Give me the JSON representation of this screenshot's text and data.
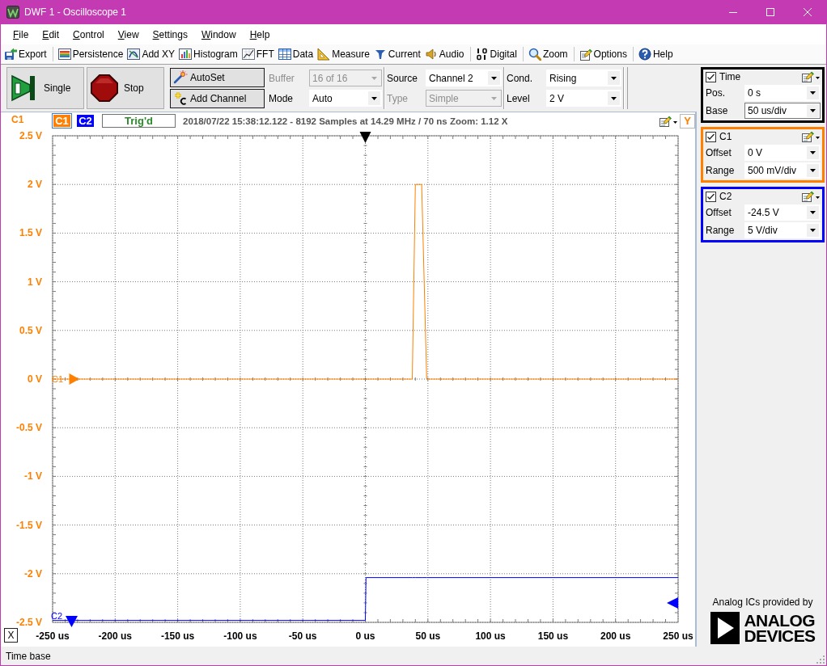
{
  "window": {
    "title": "DWF 1 - Oscilloscope 1"
  },
  "menu": [
    "File",
    "Edit",
    "Control",
    "View",
    "Settings",
    "Window",
    "Help"
  ],
  "toolbar": [
    [
      "Export"
    ],
    [
      "Persistence",
      "Add XY",
      "Histogram",
      "FFT",
      "Data",
      "Measure",
      "Current",
      "Audio"
    ],
    [
      "Digital"
    ],
    [
      "Zoom"
    ],
    [
      "Options"
    ],
    [
      "Help"
    ]
  ],
  "control_bar": {
    "run_buttons": [
      "Single",
      "Stop"
    ],
    "action_buttons": [
      "AutoSet",
      "Add Channel"
    ],
    "acquisition": [
      {
        "label": "Buffer",
        "value": "16 of 16",
        "disabled": true
      },
      {
        "label": "Mode",
        "value": "Auto",
        "disabled": false
      }
    ],
    "trigger": [
      {
        "label": "Source",
        "value": "Channel 2",
        "disabled": false
      },
      {
        "label": "Type",
        "value": "Simple",
        "disabled": true
      },
      {
        "label": "Cond.",
        "value": "Rising",
        "disabled": false
      },
      {
        "label": "Level",
        "value": "2 V",
        "disabled": false
      }
    ]
  },
  "plot": {
    "channels": [
      {
        "label": "C1",
        "color": "#ff8000",
        "selected": true
      },
      {
        "label": "C2",
        "color": "#0000ff",
        "selected": false
      }
    ],
    "status": "Trig'd",
    "info": "2018/07/22 15:38:12.122 - 8192 Samples at 14.29 MHz / 70 ns Zoom: 1.12 X",
    "y_button": "Y",
    "x_button": "X",
    "offset_markers": [
      {
        "kind": "left",
        "color": "#ff8000"
      },
      {
        "kind": "bottom",
        "color": "#0000ff"
      }
    ],
    "chart_data": {
      "type": "line",
      "ylabel": "C1",
      "grid": true,
      "legend": true,
      "x": [
        -250,
        0,
        0.5,
        37.5,
        40,
        45,
        49,
        250
      ],
      "series": [
        {
          "name": "C1",
          "color": "#ff8000",
          "values": [
            0,
            0,
            0,
            0,
            2,
            2,
            0,
            0
          ]
        },
        {
          "name": "C2",
          "color": "#0000ff",
          "values": [
            -2.48,
            -2.48,
            -2.04,
            -2.04,
            -2.04,
            -2.04,
            -2.04,
            -2.04
          ]
        }
      ],
      "xlim": [
        -250,
        250
      ],
      "ylim": [
        -2.5,
        2.5
      ],
      "xticks": [
        {
          "value": -250,
          "label": "-250 us"
        },
        {
          "value": -200,
          "label": "-200 us"
        },
        {
          "value": -150,
          "label": "-150 us"
        },
        {
          "value": -100,
          "label": "-100 us"
        },
        {
          "value": -50,
          "label": "-50 us"
        },
        {
          "value": 0,
          "label": "0 us"
        },
        {
          "value": 50,
          "label": "50 us"
        },
        {
          "value": 100,
          "label": "100 us"
        },
        {
          "value": 150,
          "label": "150 us"
        },
        {
          "value": 200,
          "label": "200 us"
        },
        {
          "value": 250,
          "label": "250 us"
        }
      ],
      "yticks": [
        {
          "value": 2.5,
          "label": "2.5 V"
        },
        {
          "value": 2,
          "label": "2 V"
        },
        {
          "value": 1.5,
          "label": "1.5 V"
        },
        {
          "value": 1,
          "label": "1 V"
        },
        {
          "value": 0.5,
          "label": "0.5 V"
        },
        {
          "value": 0,
          "label": "0 V"
        },
        {
          "value": -0.5,
          "label": "-0.5 V"
        },
        {
          "value": -1,
          "label": "-1 V"
        },
        {
          "value": -1.5,
          "label": "-1.5 V"
        },
        {
          "value": -2,
          "label": "-2 V"
        },
        {
          "value": -2.5,
          "label": "-2.5 V"
        }
      ]
    }
  },
  "panels": [
    {
      "title": "Time",
      "color": "#000000",
      "checked": true,
      "rows": [
        {
          "label": "Pos.",
          "value": "0 s",
          "focused": false
        },
        {
          "label": "Base",
          "value": "50 us/div",
          "focused": true
        }
      ]
    },
    {
      "title": "C1",
      "color": "#ff8000",
      "checked": true,
      "rows": [
        {
          "label": "Offset",
          "value": "0 V",
          "focused": false
        },
        {
          "label": "Range",
          "value": "500 mV/div",
          "focused": false
        }
      ]
    },
    {
      "title": "C2",
      "color": "#0000ff",
      "checked": true,
      "rows": [
        {
          "label": "Offset",
          "value": "-24.5 V",
          "focused": false
        },
        {
          "label": "Range",
          "value": "5 V/div",
          "focused": false
        }
      ]
    }
  ],
  "credit": "Analog ICs provided by",
  "logo": [
    "ANALOG",
    "DEVICES"
  ],
  "status_bar": "Time base"
}
